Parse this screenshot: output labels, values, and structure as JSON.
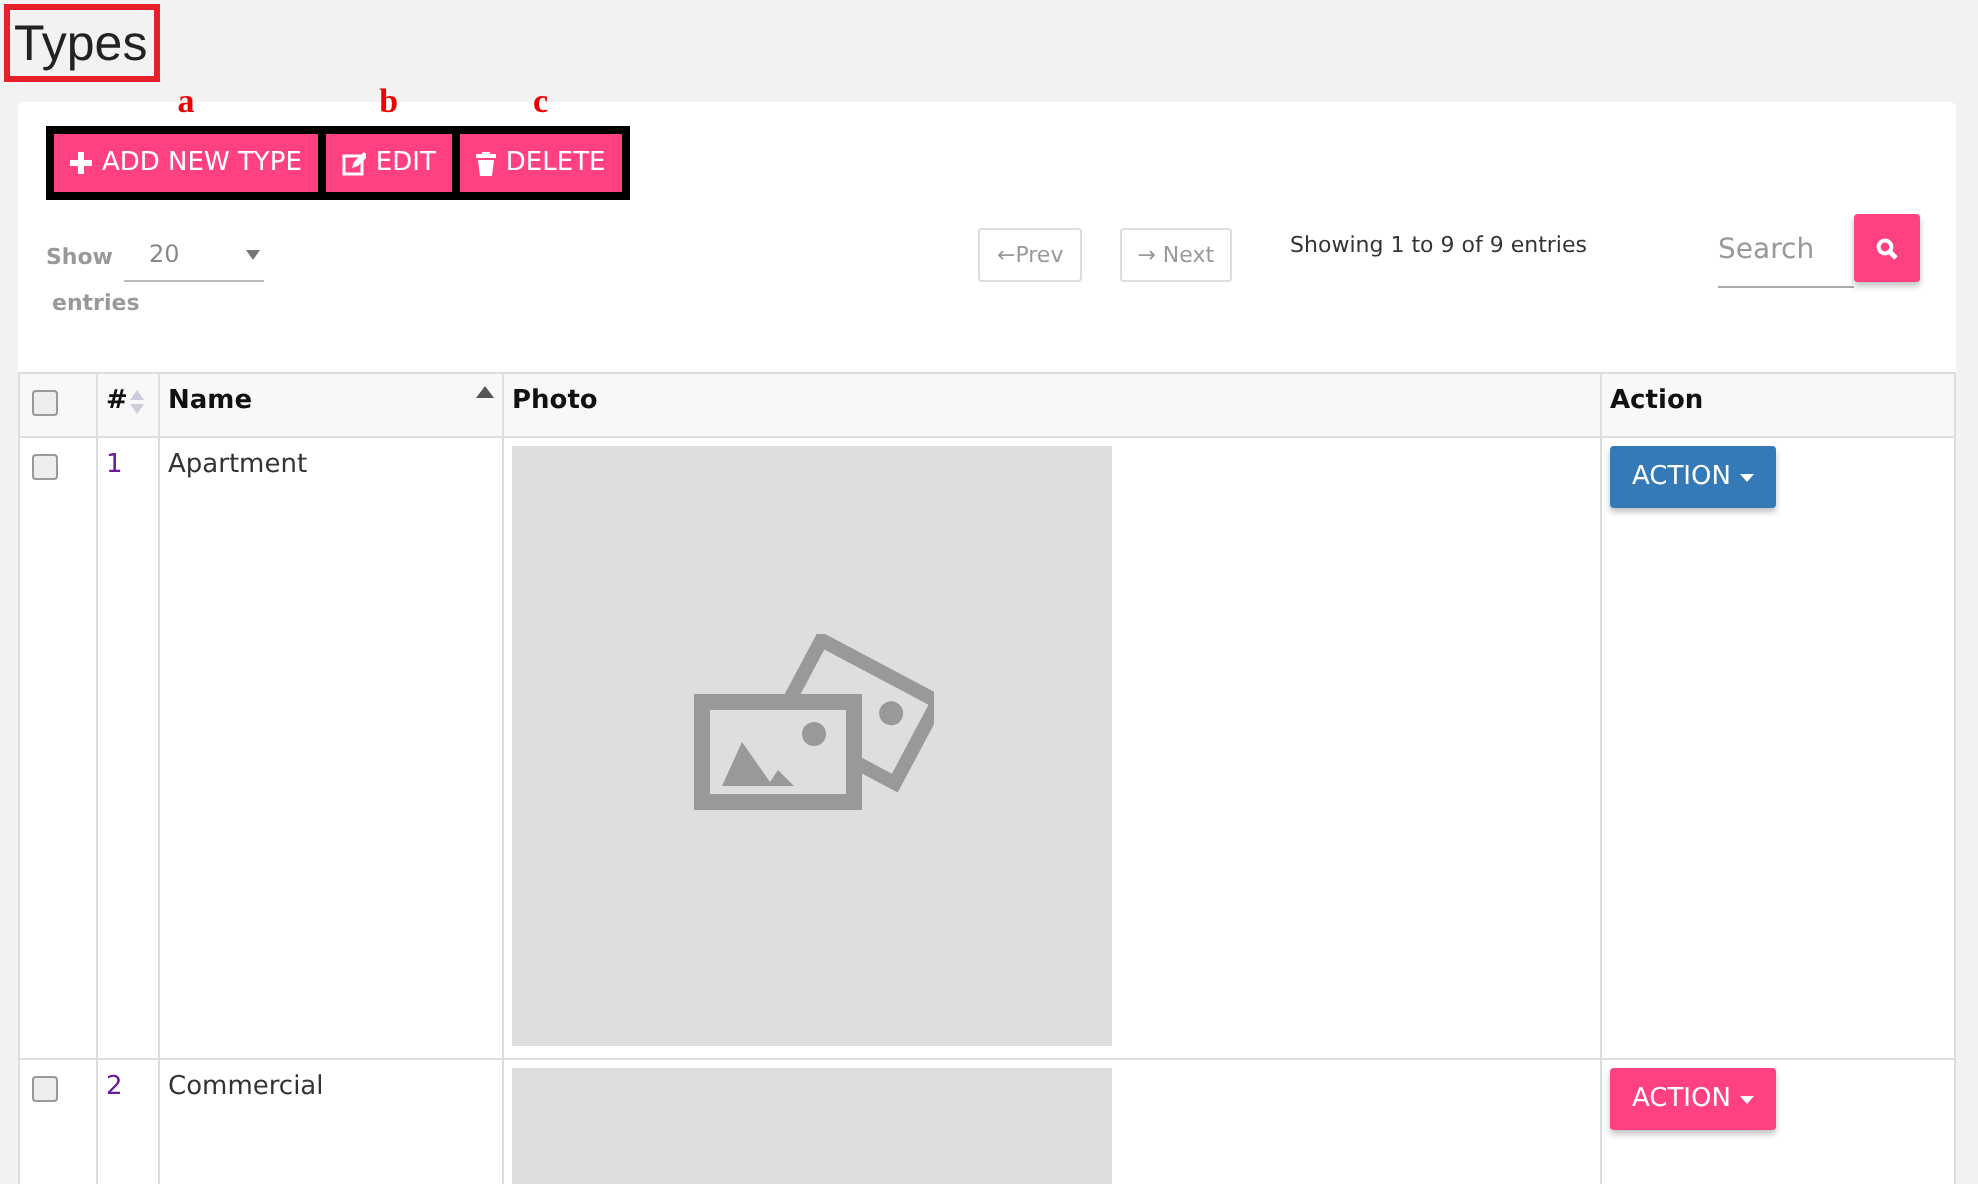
{
  "page_title": "Types",
  "toolbar": [
    {
      "kind": "add",
      "label": "ADD NEW TYPE",
      "annotation": "a"
    },
    {
      "kind": "edit",
      "label": "EDIT",
      "annotation": "b"
    },
    {
      "kind": "delete",
      "label": "DELETE",
      "annotation": "c"
    }
  ],
  "length_menu": {
    "show": "Show",
    "value": "20",
    "entries": "entries"
  },
  "pagination": {
    "prev": "←Prev",
    "next": "→ Next"
  },
  "info": "Showing 1 to 9 of 9 entries",
  "search": {
    "placeholder": "Search"
  },
  "table": {
    "select_all_checked": false,
    "columns": [
      {
        "kind": "check"
      },
      {
        "kind": "num",
        "label": "#"
      },
      {
        "kind": "name",
        "label": "Name"
      },
      {
        "kind": "photo",
        "label": "Photo"
      },
      {
        "kind": "action",
        "label": "Action"
      }
    ],
    "rows": [
      {
        "checked": false,
        "number": "1",
        "name": "Apartment",
        "photo_icon": true,
        "action": {
          "label": "ACTION",
          "color": "#337ab7"
        }
      },
      {
        "checked": false,
        "number": "2",
        "name": "Commercial",
        "action": {
          "label": "ACTION",
          "color": "#ff4081"
        }
      }
    ]
  }
}
